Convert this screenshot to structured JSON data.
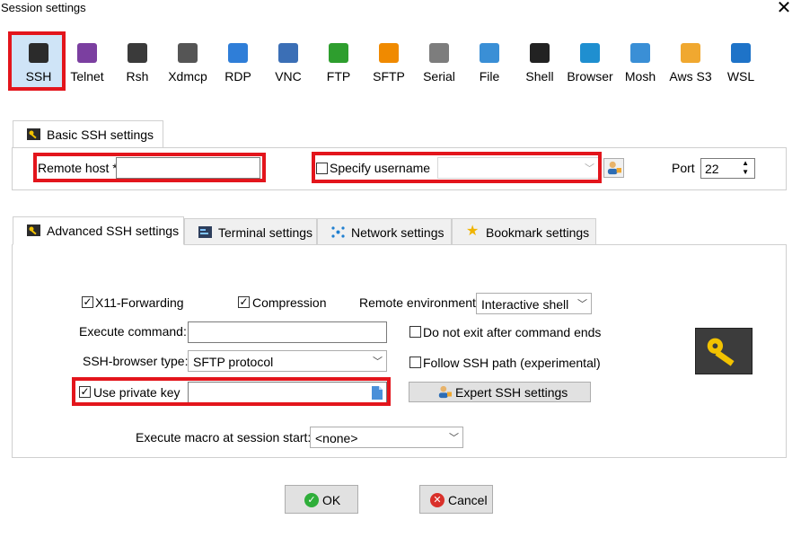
{
  "window": {
    "title": "Session settings",
    "close_glyph": "✕"
  },
  "session_types": [
    {
      "label": "SSH",
      "icon": "ssh-key-icon",
      "color": "#2b2b2b"
    },
    {
      "label": "Telnet",
      "icon": "telnet-icon",
      "color": "#7b3fa0"
    },
    {
      "label": "Rsh",
      "icon": "rsh-icon",
      "color": "#3a3a3a"
    },
    {
      "label": "Xdmcp",
      "icon": "xdmcp-icon",
      "color": "#555555"
    },
    {
      "label": "RDP",
      "icon": "rdp-icon",
      "color": "#2f7ed8"
    },
    {
      "label": "VNC",
      "icon": "vnc-icon",
      "color": "#3b6fb6"
    },
    {
      "label": "FTP",
      "icon": "ftp-icon",
      "color": "#2e9e2e"
    },
    {
      "label": "SFTP",
      "icon": "sftp-icon",
      "color": "#f08a00"
    },
    {
      "label": "Serial",
      "icon": "serial-icon",
      "color": "#7d7d7d"
    },
    {
      "label": "File",
      "icon": "file-icon",
      "color": "#3a8fd6"
    },
    {
      "label": "Shell",
      "icon": "shell-icon",
      "color": "#222222"
    },
    {
      "label": "Browser",
      "icon": "browser-globe-icon",
      "color": "#1f8fd0"
    },
    {
      "label": "Mosh",
      "icon": "mosh-icon",
      "color": "#3a8fd6"
    },
    {
      "label": "Aws S3",
      "icon": "aws-s3-icon",
      "color": "#f0a830"
    },
    {
      "label": "WSL",
      "icon": "windows-icon",
      "color": "#1e73c8"
    }
  ],
  "basic": {
    "tab_label": "Basic SSH settings",
    "remote_host_label": "Remote host *",
    "remote_host_value": "",
    "specify_username_label": "Specify username",
    "specify_username_checked": false,
    "username_value": "",
    "port_label": "Port",
    "port_value": "22"
  },
  "tabs": [
    {
      "label": "Advanced SSH settings",
      "active": true
    },
    {
      "label": "Terminal settings",
      "active": false
    },
    {
      "label": "Network settings",
      "active": false
    },
    {
      "label": "Bookmark settings",
      "active": false
    }
  ],
  "advanced": {
    "x11_label": "X11-Forwarding",
    "x11_checked": true,
    "compression_label": "Compression",
    "compression_checked": true,
    "remote_env_label": "Remote environment:",
    "remote_env_value": "Interactive shell",
    "execute_command_label": "Execute command:",
    "execute_command_value": "",
    "no_exit_label": "Do not exit after command ends",
    "no_exit_checked": false,
    "ssh_browser_label": "SSH-browser type:",
    "ssh_browser_value": "SFTP protocol",
    "follow_path_label": "Follow SSH path (experimental)",
    "follow_path_checked": false,
    "use_private_key_label": "Use private key",
    "use_private_key_checked": true,
    "private_key_value": "",
    "expert_button_label": "Expert SSH settings",
    "macro_label": "Execute macro at session start:",
    "macro_value": "<none>"
  },
  "footer": {
    "ok_label": "OK",
    "cancel_label": "Cancel"
  },
  "colors": {
    "highlight_red": "#e3151c",
    "selected_bg": "#cfe4f7",
    "ok_green": "#2fae3a",
    "cancel_red": "#d9302a"
  }
}
